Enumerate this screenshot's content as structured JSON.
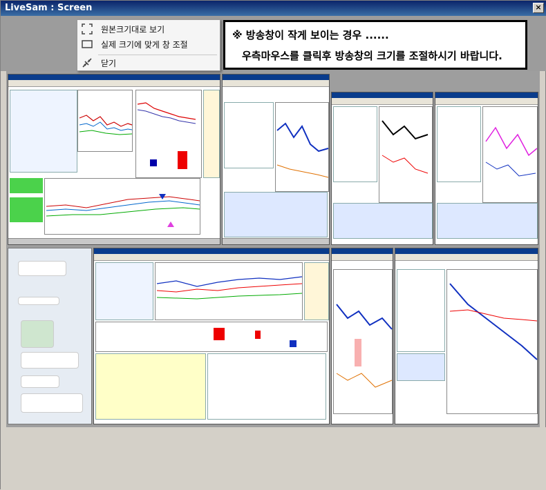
{
  "window": {
    "title": "LiveSam : Screen",
    "close_glyph": "×"
  },
  "context_menu": {
    "items": [
      {
        "label": "원본크기대로 보기",
        "icon": "expand-icon"
      },
      {
        "label": "실제 크기에 맞게 창 조절",
        "icon": "window-icon"
      },
      {
        "label": "닫기",
        "icon": "disconnect-icon"
      }
    ]
  },
  "notice": {
    "line1": "※ 방송창이 작게 보이는 경우 ......",
    "line2": "우측마우스를 클릭후 방송창의 크기를 조절하시기 바랍니다."
  },
  "colors": {
    "titlebar": "#0a246a",
    "accent_red": "#e00000",
    "accent_blue": "#1030c0",
    "chart_bg": "#ffffff"
  }
}
